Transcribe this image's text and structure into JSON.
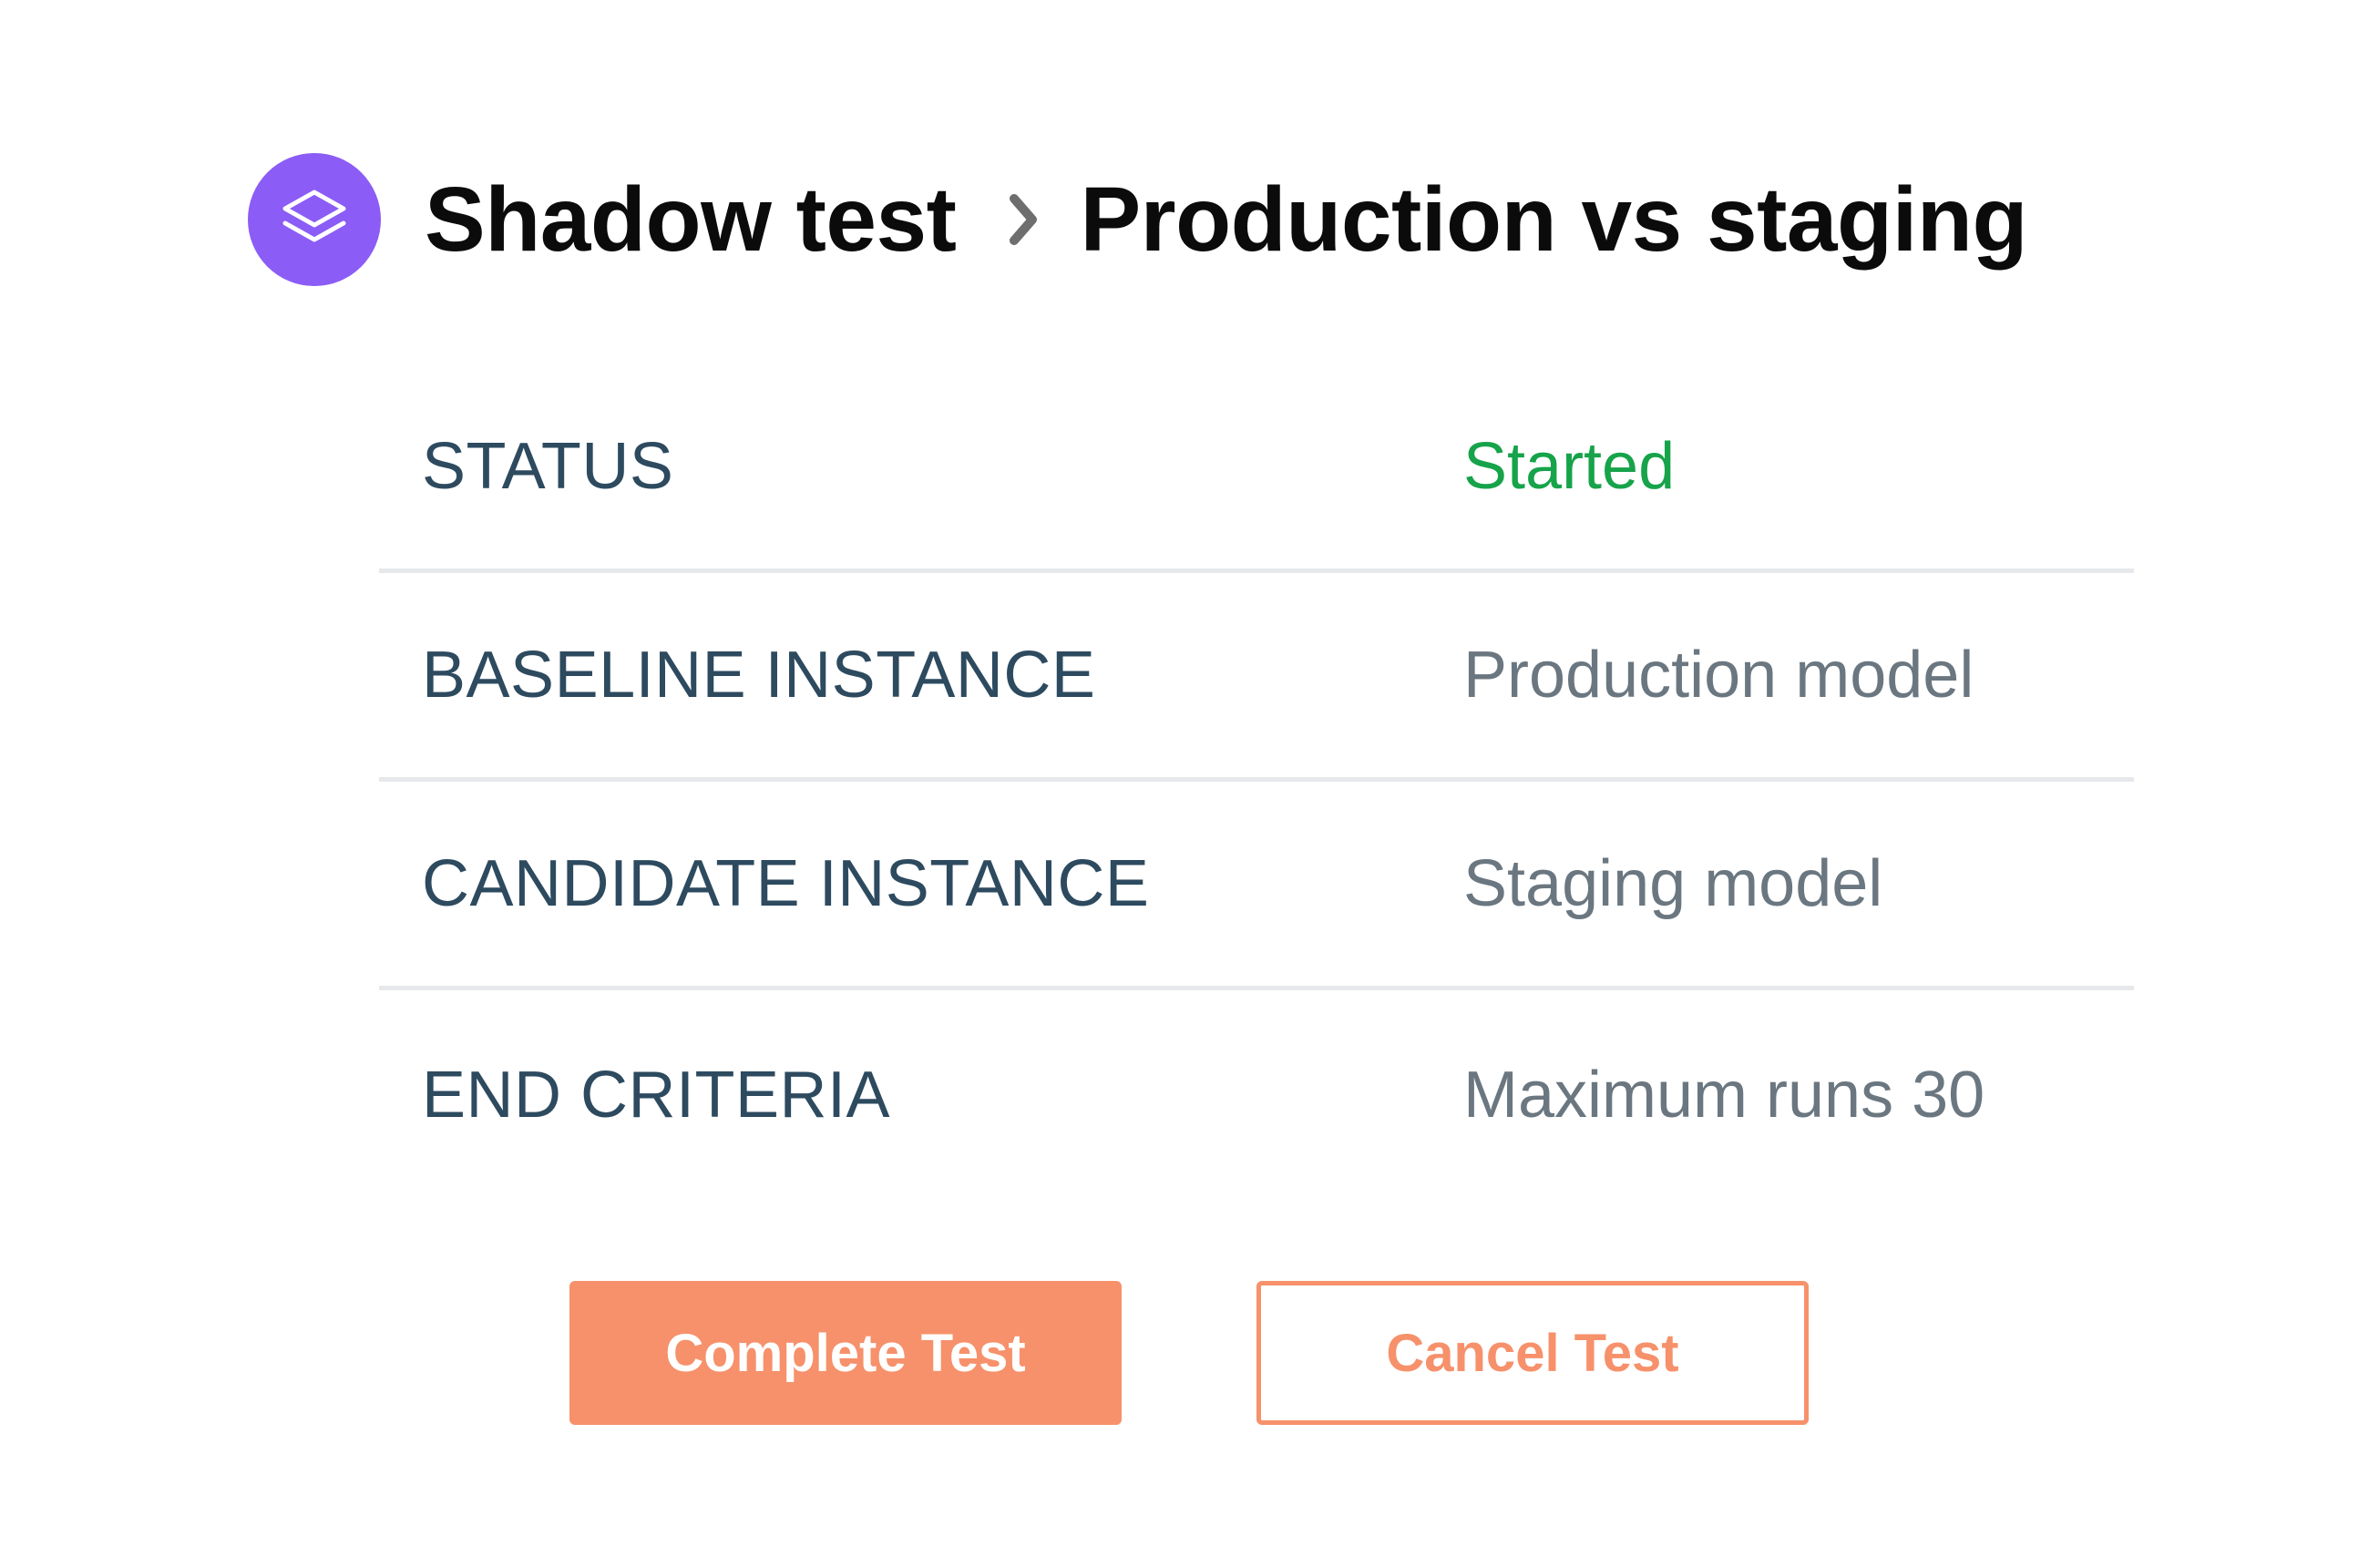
{
  "header": {
    "logo_icon": "layers-icon",
    "logo_color": "#8b5cf6",
    "breadcrumb": {
      "parent": "Shadow test",
      "separator_icon": "chevron-right-icon",
      "current": "Production vs staging"
    }
  },
  "details": {
    "rows": [
      {
        "label": "STATUS",
        "value": "Started"
      },
      {
        "label": "BASELINE INSTANCE",
        "value": "Production model"
      },
      {
        "label": "CANDIDATE INSTANCE",
        "value": "Staging model"
      },
      {
        "label": "END CRITERIA",
        "value": "Maximum runs 30"
      }
    ]
  },
  "actions": {
    "complete_label": "Complete Test",
    "cancel_label": "Cancel Test"
  },
  "colors": {
    "accent": "#f6916b",
    "status_started": "#16a34a",
    "label": "#2d4a5f",
    "value": "#6b7780",
    "divider": "#e6e8eb"
  }
}
